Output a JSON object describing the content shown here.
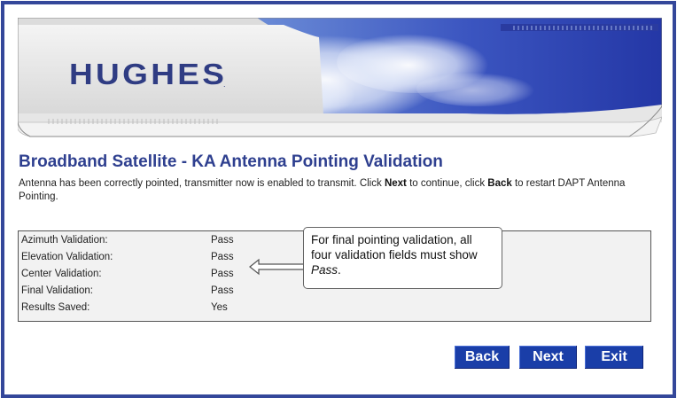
{
  "banner": {
    "logo_text": "HUGHES",
    "logo_mark": "."
  },
  "page": {
    "title": "Broadband Satellite - KA Antenna Pointing Validation",
    "description_parts": [
      "Antenna has been correctly pointed, transmitter now is enabled to transmit. Click ",
      "Next",
      " to continue, click ",
      "Back",
      " to restart DAPT Antenna Pointing."
    ]
  },
  "validation": {
    "rows": [
      {
        "label": "Azimuth Validation:",
        "value": "Pass"
      },
      {
        "label": "Elevation Validation:",
        "value": "Pass"
      },
      {
        "label": "Center Validation:",
        "value": "Pass"
      },
      {
        "label": "Final Validation:",
        "value": "Pass"
      },
      {
        "label": "Results Saved:",
        "value": "Yes"
      }
    ]
  },
  "callout": {
    "text": "For final pointing validation, all four validation fields must show ",
    "emphasis": "Pass",
    "end": "."
  },
  "buttons": {
    "back": "Back",
    "next": "Next",
    "exit": "Exit"
  },
  "colors": {
    "frame": "#34479a",
    "title": "#2e3f8f",
    "button": "#1a3ea8"
  }
}
